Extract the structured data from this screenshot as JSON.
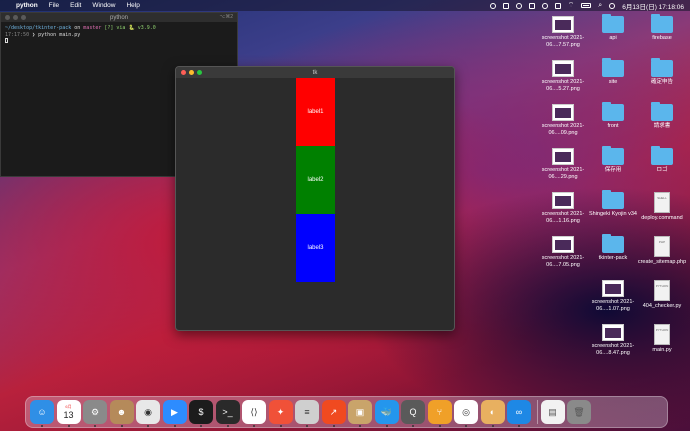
{
  "menubar": {
    "app": "python",
    "items": [
      "File",
      "Edit",
      "Window",
      "Help"
    ],
    "datetime": "6月13日(日)  17:18:06"
  },
  "terminal": {
    "title": "python",
    "shortcut": "⌥⌘2",
    "line1_path": "~/desktop/tkinter-pack",
    "line1_on": "on",
    "line1_branch": "master",
    "line1_rest": "[?] via 🐍 v3.9.0",
    "line2_time": "17:17:50",
    "line2_cmd": "❯ python main.py"
  },
  "tkwindow": {
    "title": "tk",
    "labels": [
      {
        "text": "label1",
        "color": "#ff0000"
      },
      {
        "text": "label2",
        "color": "#008000"
      },
      {
        "text": "label3",
        "color": "#0000ff"
      }
    ]
  },
  "desktop": {
    "col1": [
      {
        "label": "screenshot 2021-06....7.57.png",
        "icon": "screenshot-thumb"
      },
      {
        "label": "screenshot 2021-06....5.27.png",
        "icon": "screenshot-thumb"
      },
      {
        "label": "screenshot 2021-06....09.png",
        "icon": "screenshot-thumb"
      },
      {
        "label": "screenshot 2021-06....29.png",
        "icon": "screenshot-thumb"
      },
      {
        "label": "screenshot 2021-06....1.16.png",
        "icon": "screenshot-thumb"
      },
      {
        "label": "screenshot 2021-06....7.05.png",
        "icon": "screenshot-thumb"
      }
    ],
    "col2": [
      {
        "label": "api",
        "icon": "folder"
      },
      {
        "label": "site",
        "icon": "folder"
      },
      {
        "label": "front",
        "icon": "folder"
      },
      {
        "label": "保存用",
        "icon": "folder"
      },
      {
        "label": "Shingeki Kyojin v34",
        "icon": "folder"
      },
      {
        "label": "tkinter-pack",
        "icon": "folder"
      },
      {
        "label": "screenshot 2021-06....1.07.png",
        "icon": "screenshot-thumb"
      },
      {
        "label": "screenshot 2021-06....8.47.png",
        "icon": "screenshot-thumb"
      }
    ],
    "col3": [
      {
        "label": "firebase",
        "icon": "folder",
        "badge": ""
      },
      {
        "label": "確定申告",
        "icon": "folder",
        "badge": ""
      },
      {
        "label": "請求書",
        "icon": "folder",
        "badge": ""
      },
      {
        "label": "ロゴ",
        "icon": "folder",
        "badge": ""
      },
      {
        "label": "deploy.command",
        "icon": "document",
        "badge": "SHELL"
      },
      {
        "label": "create_sitemap.php",
        "icon": "document",
        "badge": "PHP"
      },
      {
        "label": "404_checker.py",
        "icon": "document",
        "badge": "PYTHON"
      },
      {
        "label": "main.py",
        "icon": "document",
        "badge": "PYTHON"
      }
    ]
  },
  "dock": {
    "calendar_month": "6月",
    "calendar_day": "13",
    "apps": [
      {
        "name": "finder-icon",
        "color": "#2f8fe6",
        "glyph": "☺"
      },
      {
        "name": "calendar-icon",
        "color": "#ffffff",
        "glyph": ""
      },
      {
        "name": "system-preferences-icon",
        "color": "#8a8a8a",
        "glyph": "⚙"
      },
      {
        "name": "contacts-icon",
        "color": "#b58a5a",
        "glyph": "☻"
      },
      {
        "name": "chrome-icon",
        "color": "#e8e8e8",
        "glyph": "◉"
      },
      {
        "name": "zoom-icon",
        "color": "#2d8cff",
        "glyph": "▶"
      },
      {
        "name": "iterm-icon",
        "color": "#1c1c1c",
        "glyph": "$"
      },
      {
        "name": "terminal-icon",
        "color": "#2a2a2a",
        "glyph": ">_"
      },
      {
        "name": "vscode-icon",
        "color": "#ffffff",
        "glyph": "⟨⟩"
      },
      {
        "name": "swift-playgrounds-icon",
        "color": "#f05138",
        "glyph": "✦"
      },
      {
        "name": "sequel-ace-icon",
        "color": "#cfcfcf",
        "glyph": "≡"
      },
      {
        "name": "activity-app-icon",
        "color": "#f04a20",
        "glyph": "↗"
      },
      {
        "name": "package-icon",
        "color": "#c9a46a",
        "glyph": "▣"
      },
      {
        "name": "docker-icon",
        "color": "#2496ed",
        "glyph": "🐳"
      },
      {
        "name": "quicktime-icon",
        "color": "#5a5a5a",
        "glyph": "Q"
      },
      {
        "name": "sourcetree-icon",
        "color": "#f0a028",
        "glyph": "⑂"
      },
      {
        "name": "pulse-icon",
        "color": "#ffffff",
        "glyph": "◎"
      },
      {
        "name": "preview-icon",
        "color": "#e8b060",
        "glyph": "◐"
      },
      {
        "name": "infinity-app-icon",
        "color": "#1e88e5",
        "glyph": "∞"
      }
    ],
    "right_items": [
      {
        "name": "document-stack-icon",
        "color": "#f2f2f2",
        "glyph": "▤"
      },
      {
        "name": "trash-icon",
        "color": "#8a8a8a",
        "glyph": "🗑"
      }
    ]
  }
}
